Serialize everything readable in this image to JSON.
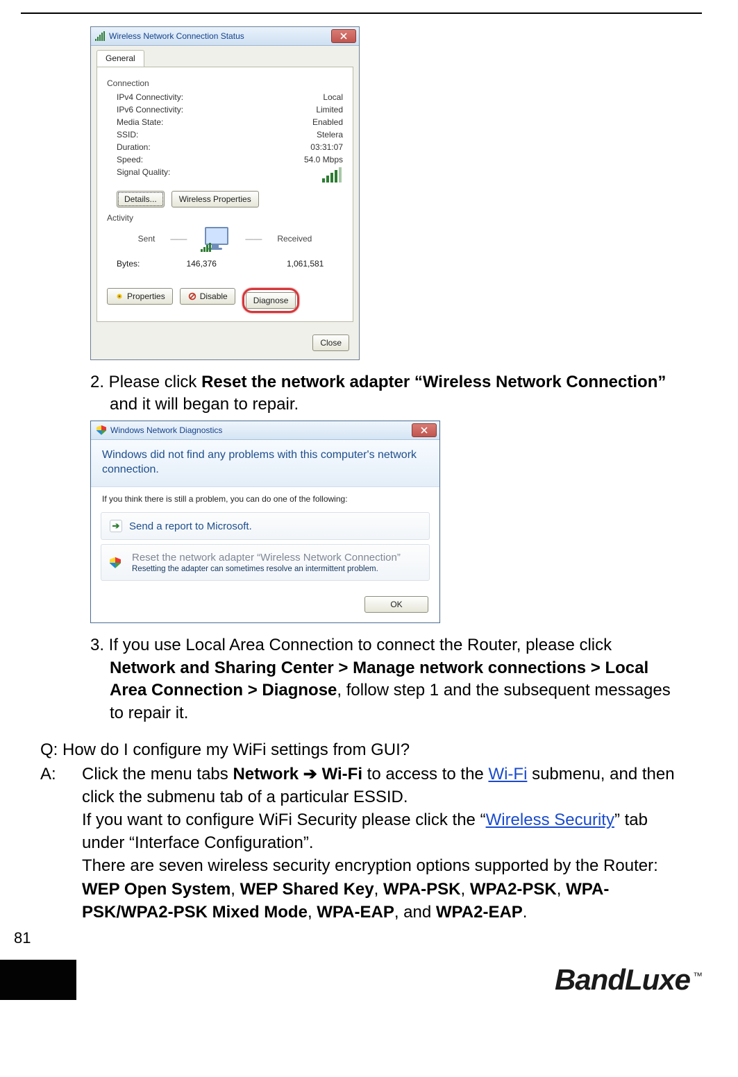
{
  "dialog1": {
    "title": "Wireless Network Connection Status",
    "tab": "General",
    "group_connection": "Connection",
    "rows": {
      "ipv4_k": "IPv4 Connectivity:",
      "ipv4_v": "Local",
      "ipv6_k": "IPv6 Connectivity:",
      "ipv6_v": "Limited",
      "media_k": "Media State:",
      "media_v": "Enabled",
      "ssid_k": "SSID:",
      "ssid_v": "Stelera",
      "dur_k": "Duration:",
      "dur_v": "03:31:07",
      "spd_k": "Speed:",
      "spd_v": "54.0 Mbps",
      "sigq_k": "Signal Quality:"
    },
    "btn_details": "Details...",
    "btn_wprops": "Wireless Properties",
    "group_activity": "Activity",
    "sent_label": "Sent",
    "recv_label": "Received",
    "bytes_label": "Bytes:",
    "bytes_sent": "146,376",
    "bytes_recv": "1,061,581",
    "btn_properties": "Properties",
    "btn_disable": "Disable",
    "btn_diagnose": "Diagnose",
    "btn_close": "Close"
  },
  "step2": {
    "prefix": "2. Please click ",
    "bold": "Reset the network adapter “Wireless Network Connection”",
    "suffix": " and it will began to repair."
  },
  "dialog2": {
    "title": "Windows Network Diagnostics",
    "banner_line1": "Windows did not find any problems with this computer's network",
    "banner_line2": "connection.",
    "hint": "If you think there is still a problem, you can do one of the following:",
    "opt1_title": "Send a report to Microsoft.",
    "opt2_title": "Reset the network adapter “Wireless Network Connection”",
    "opt2_sub": "Resetting the adapter can sometimes resolve an intermittent problem.",
    "btn_ok": "OK"
  },
  "step3": {
    "prefix": "3. If you use Local Area Connection to connect the Router, please click ",
    "bold": "Network and Sharing Center > Manage network connections > Local Area Connection > Diagnose",
    "suffix": ", follow step 1 and the subsequent messages to repair it."
  },
  "qa": {
    "q": "Q: How do I configure my WiFi settings from GUI?",
    "a_label": "A:",
    "a1_pre": "Click the menu tabs ",
    "a1_bold": "Network ➔ Wi-Fi",
    "a1_mid": " to access to the ",
    "link_wifi": "Wi-Fi",
    "a1_post": " submenu, and then click the submenu tab of a particular ESSID.",
    "a2_pre": "If you want to configure WiFi Security please click the “",
    "link_ws": "Wireless Security",
    "a2_post": "” tab under “Interface Configuration”.",
    "a3_pre": "There are seven wireless security encryption options supported by the Router: ",
    "b1": "WEP Open System",
    "c1": ", ",
    "b2": "WEP Shared Key",
    "c2": ", ",
    "b3": "WPA-PSK",
    "c3": ", ",
    "b4": "WPA2-PSK",
    "c4": ", ",
    "b5": "WPA-PSK/WPA2-PSK Mixed Mode",
    "c5": ", ",
    "b6": "WPA-EAP",
    "c6": ", and ",
    "b7": "WPA2-EAP",
    "c7": "."
  },
  "page_number": "81",
  "brand": {
    "text": "BandLuxe",
    "tm": "™"
  }
}
